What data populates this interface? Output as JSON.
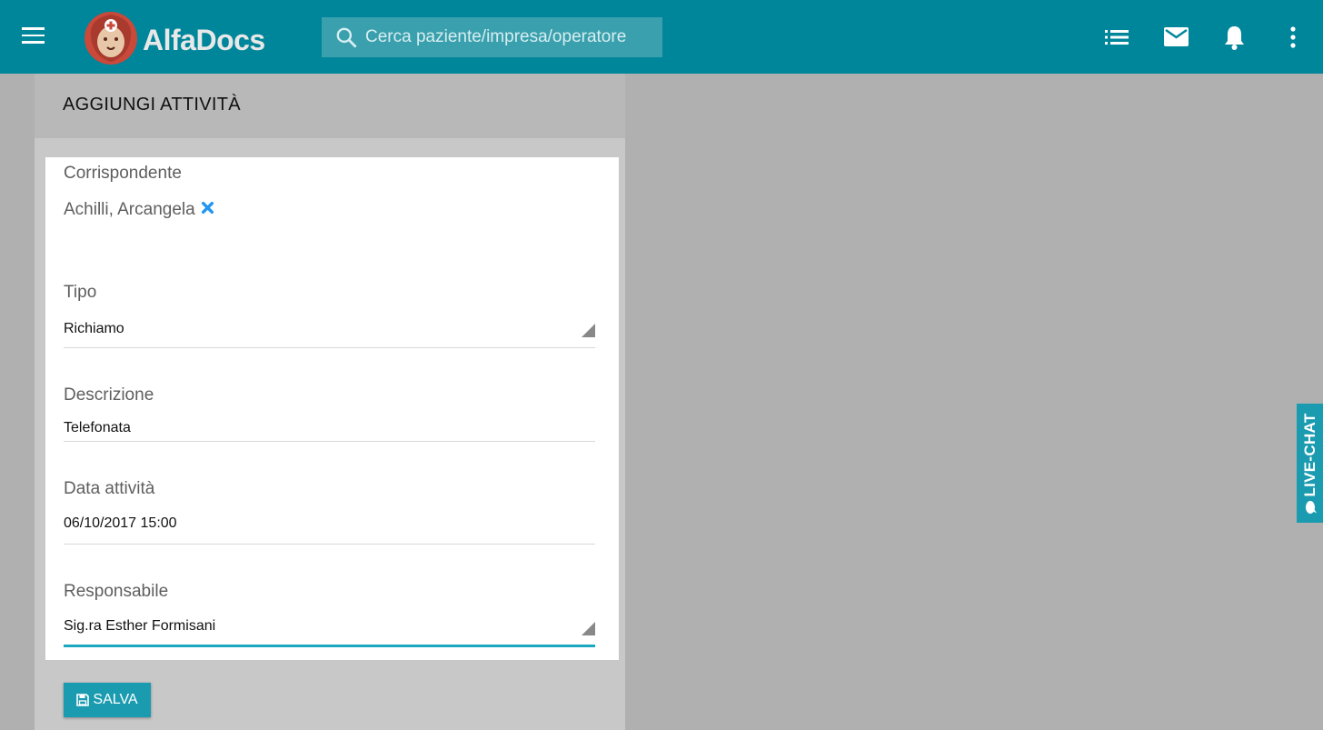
{
  "app": {
    "name": "AlfaDocs"
  },
  "search": {
    "placeholder": "Cerca paziente/impresa/operatore"
  },
  "panel": {
    "title": "AGGIUNGI ATTIVITÀ"
  },
  "form": {
    "corrispondente_label": "Corrispondente",
    "corrispondente_value": "Achilli, Arcangela",
    "tipo_label": "Tipo",
    "tipo_value": "Richiamo",
    "descrizione_label": "Descrizione",
    "descrizione_value": "Telefonata",
    "data_label": "Data attività",
    "data_value": "06/10/2017 15:00",
    "responsabile_label": "Responsabile",
    "responsabile_value": "Sig.ra Esther Formisani"
  },
  "actions": {
    "save_label": "SALVA"
  },
  "livechat": {
    "label": "LIVE-CHAT"
  },
  "icons": [
    "menu-icon",
    "search-icon",
    "list-icon",
    "mail-icon",
    "bell-icon",
    "more-vert-icon",
    "remove-icon",
    "save-icon",
    "chat-icon"
  ],
  "colors": {
    "primary": "#00869a",
    "accent": "#1a9bb0",
    "remove": "#2196f3"
  }
}
